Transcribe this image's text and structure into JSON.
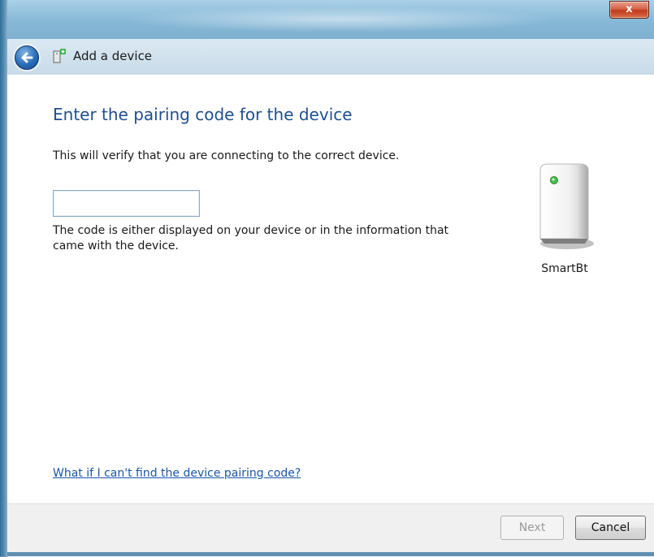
{
  "window": {
    "title": "Add a device",
    "close_label": "x"
  },
  "page": {
    "heading": "Enter the pairing code for the device",
    "description": "This will verify that you are connecting to the correct device.",
    "code_input": {
      "value": "",
      "placeholder": ""
    },
    "hint": "The code is either displayed on your device or in the information that came with the device.",
    "help_link": "What if I can't find the device pairing code?"
  },
  "device": {
    "name": "SmartBt",
    "icon": "device-tower-icon"
  },
  "buttons": {
    "next_label": "Next",
    "cancel_label": "Cancel"
  },
  "colors": {
    "heading": "#1f4f8f",
    "link": "#1a56a8",
    "close": "#c2391b"
  }
}
